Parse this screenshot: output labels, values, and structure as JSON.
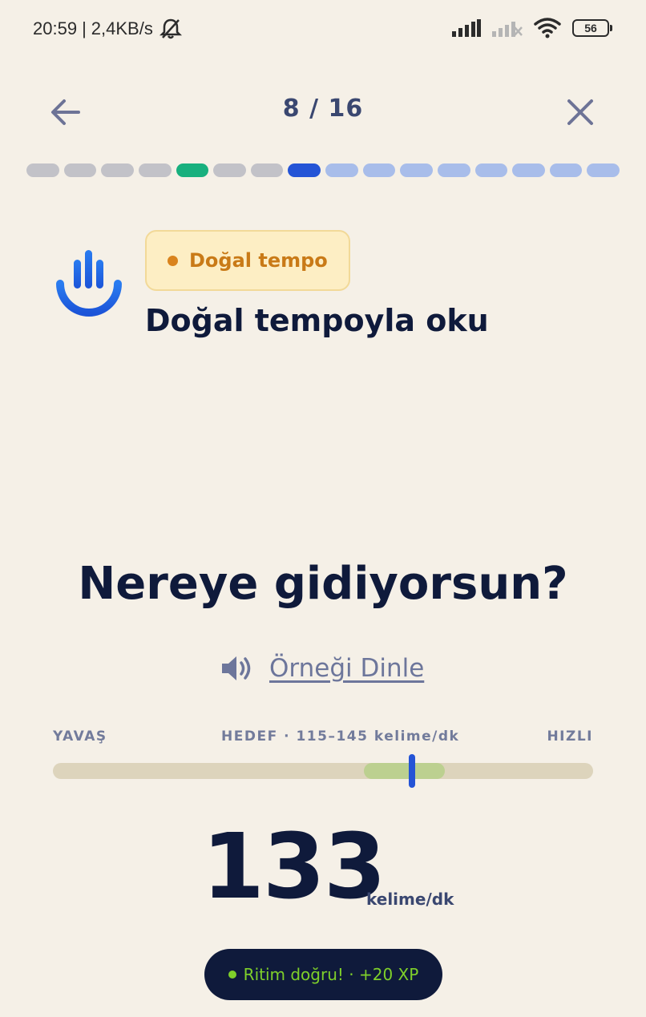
{
  "status_bar": {
    "time": "20:59",
    "speed": "2,4KB/s",
    "battery": "56"
  },
  "header": {
    "counter": "8 / 16"
  },
  "progress": {
    "segments": [
      "done",
      "done",
      "done",
      "done",
      "correct",
      "done",
      "done",
      "current",
      "todo",
      "todo",
      "todo",
      "todo",
      "todo",
      "todo",
      "todo",
      "todo"
    ]
  },
  "exercise": {
    "badge": "Doğal tempo",
    "title": "Doğal tempoyla oku",
    "sentence": "Nereye gidiyorsun?",
    "listen_label": "Örneği Dinle"
  },
  "tempo_scale": {
    "slow_label": "YAVAŞ",
    "target_label": "HEDEF · 115–145 kelime/dk",
    "fast_label": "HIZLI",
    "current_wpm": 133,
    "target_min": 115,
    "target_max": 145
  },
  "result": {
    "wpm": "133",
    "unit": "kelime/dk",
    "feedback": "Ritim doğru! · +20 XP"
  },
  "colors": {
    "background": "#f5f0e7",
    "navy": "#0f1a3b",
    "accent_blue": "#2454d6",
    "success_green": "#18b07e",
    "badge_orange": "#c97a17",
    "feedback_green": "#7fd02a"
  },
  "icons": {
    "back": "arrow-left-icon",
    "close": "close-icon",
    "logo": "hand-wave-icon",
    "speaker": "speaker-icon",
    "mute": "bell-off-icon",
    "signal": "signal-icon",
    "wifi": "wifi-icon"
  }
}
